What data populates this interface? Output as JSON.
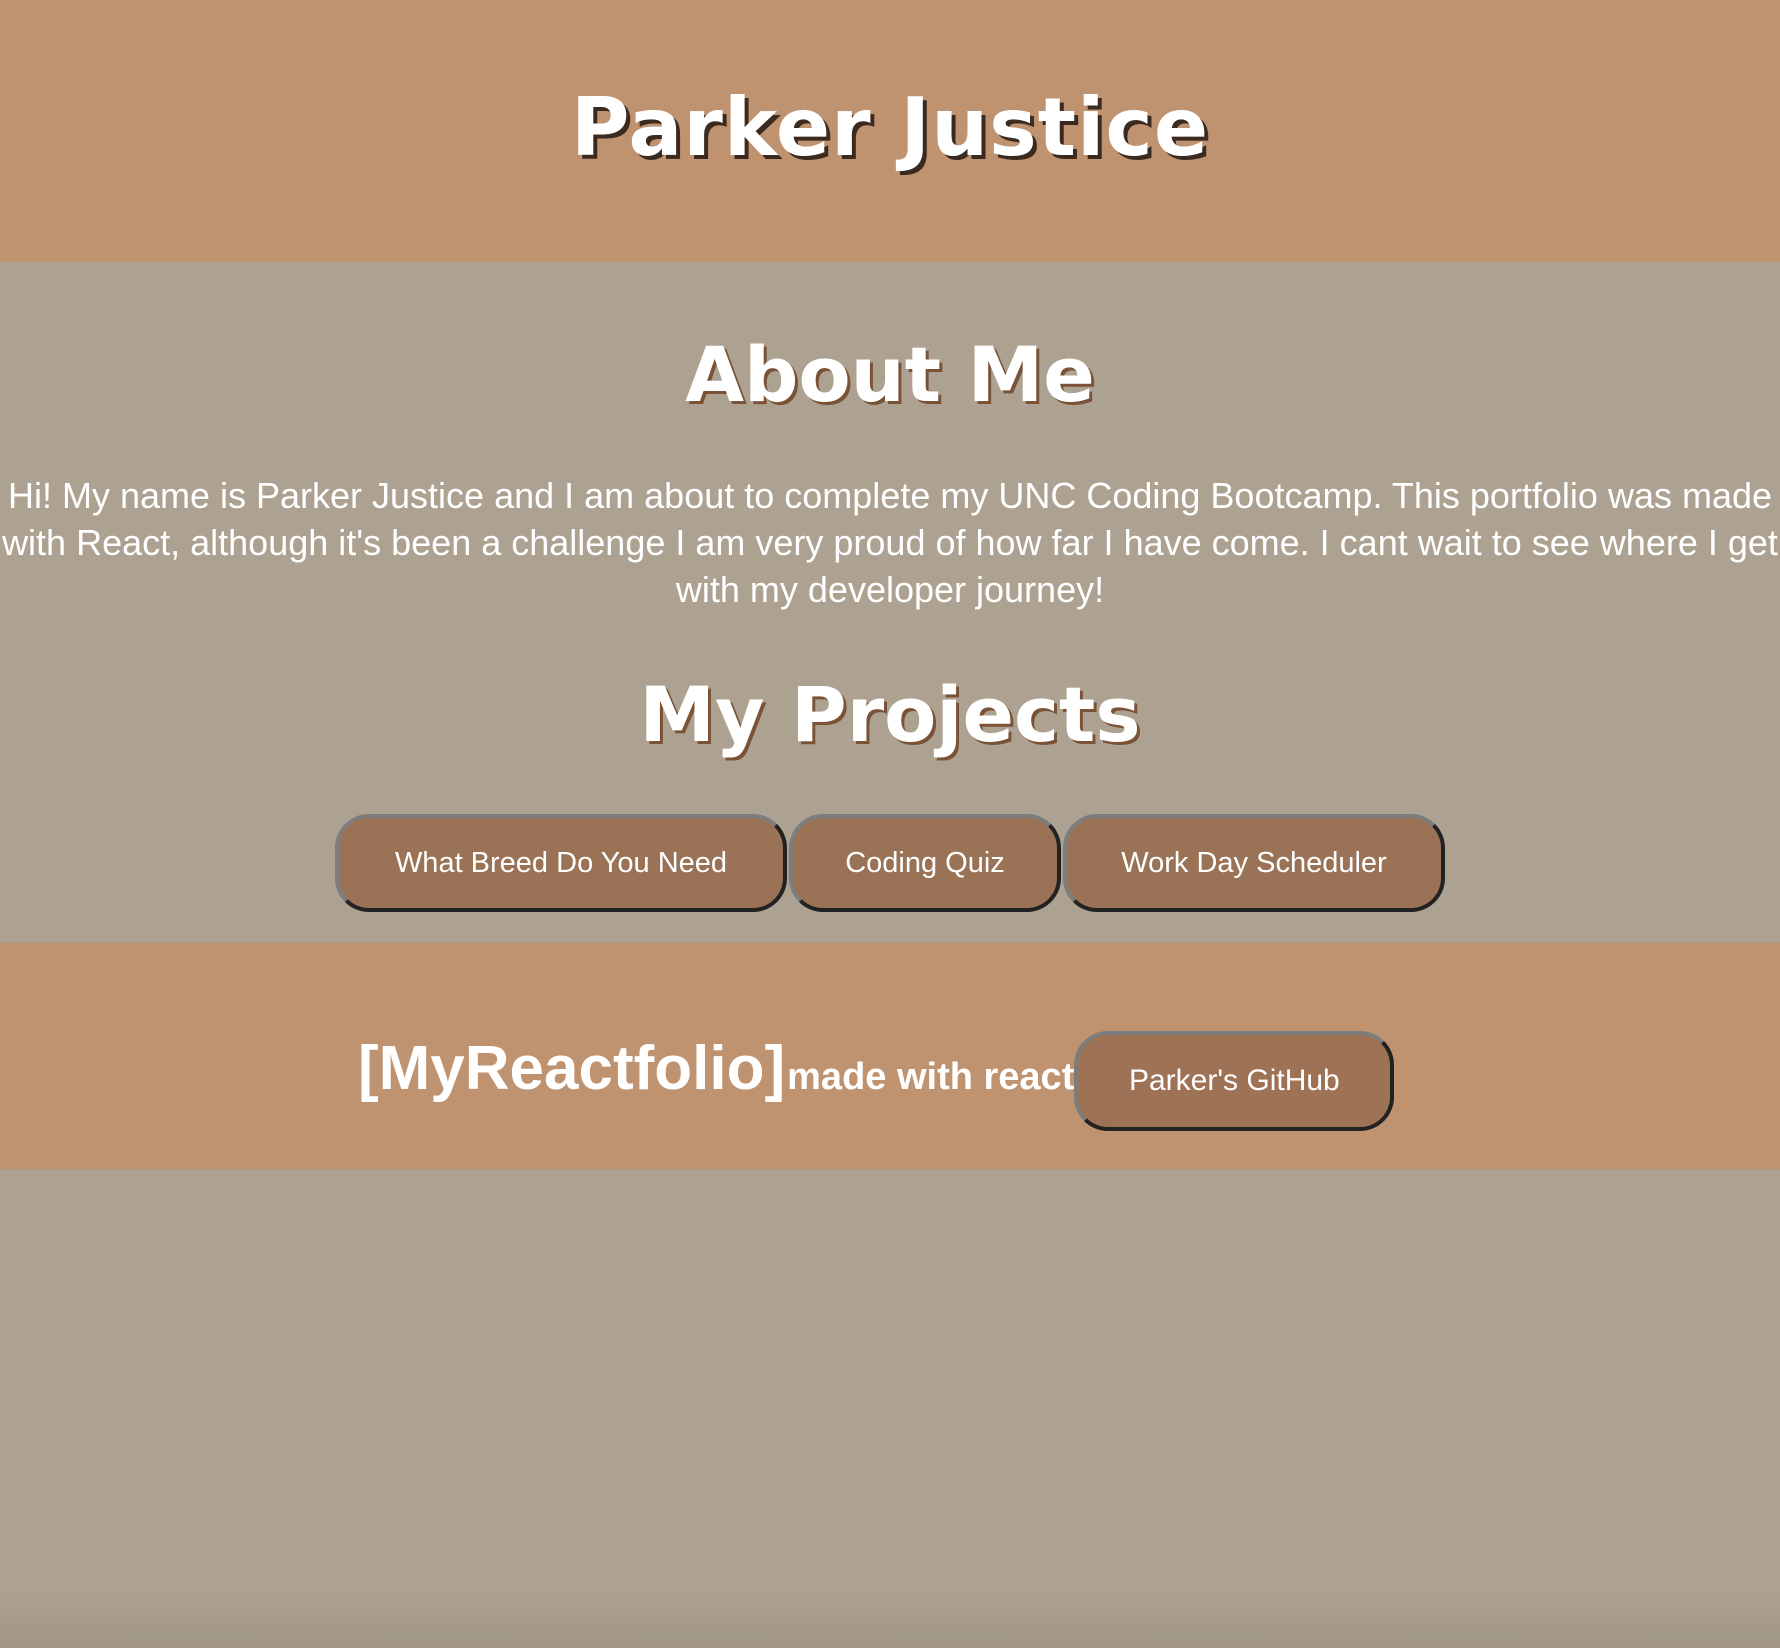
{
  "header": {
    "title": "Parker Justice"
  },
  "about": {
    "title": "About Me",
    "text": "Hi! My name is Parker Justice and I am about to complete my UNC Coding Bootcamp. This portfolio was made with React, although it's been a challenge I am very proud of how far I have come. I cant wait to see where I get with my developer journey!"
  },
  "projects": {
    "title": "My Projects",
    "items": [
      {
        "label": "What Breed Do You Need"
      },
      {
        "label": "Coding Quiz"
      },
      {
        "label": "Work Day Scheduler"
      }
    ]
  },
  "footer": {
    "brand": "[MyReactfolio]",
    "tagline": "made with react",
    "github_label": "Parker's GitHub"
  },
  "colors": {
    "header_bg": "#bf9270",
    "page_bg": "#ada291",
    "button_bg": "#9a7356",
    "text": "#ffffff"
  }
}
